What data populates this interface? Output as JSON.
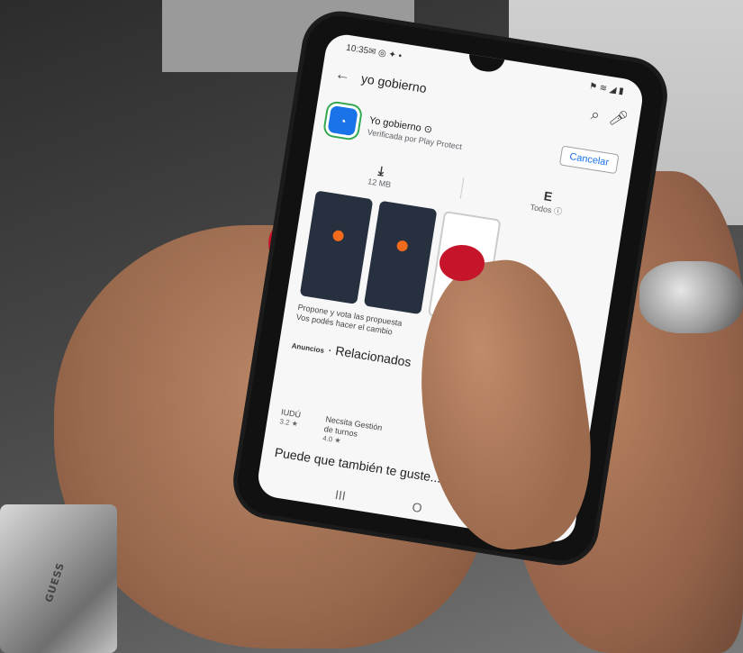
{
  "status_bar": {
    "time": "10:35",
    "icons": "✉ ◎ ✦ •",
    "right_icons": "⚑ ≋ ◢ ▮"
  },
  "search": {
    "back_icon": "arrow-left-icon",
    "query": "yo gobierno",
    "search_icon": "search-icon",
    "mic_icon": "mic-icon"
  },
  "app": {
    "name": "Yo gobierno ⊙",
    "verified": "Verificada por Play Protect",
    "cancel_label": "Cancelar"
  },
  "meta": {
    "size": "12 MB",
    "rating_letter": "E",
    "rating_text": "Todos ⓘ"
  },
  "description": {
    "line1": "Propone y vota las propuesta",
    "line2": "Vos podés hacer el cambio"
  },
  "section": {
    "ad_label": "Anuncios",
    "title": "· Relacionados"
  },
  "related": [
    {
      "name": "IUDÚ",
      "rating": "3.2 ★"
    },
    {
      "name": "Necsita Gestión de turnos",
      "rating": "4.0 ★"
    }
  ],
  "also_like": "Puede que también te guste...",
  "nav": {
    "recent": "III",
    "home": "O",
    "back": "<"
  },
  "watch": {
    "brand": "GUESS"
  },
  "colors": {
    "accent": "#1a73e8",
    "nail": "#c6152b"
  }
}
